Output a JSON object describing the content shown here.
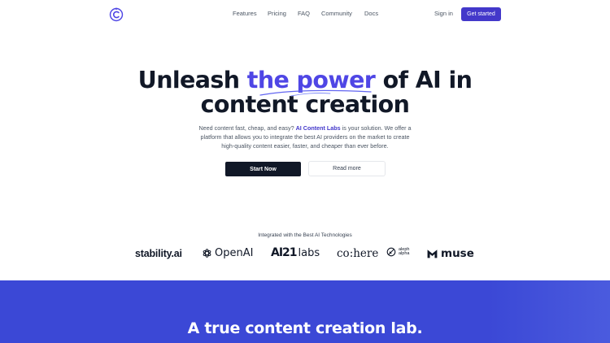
{
  "nav": {
    "links": [
      "Features",
      "Pricing",
      "FAQ",
      "Community",
      "Docs"
    ],
    "sign_in": "Sign in",
    "get_started": "Get started"
  },
  "hero": {
    "title_part1": "Unleash ",
    "title_accent": "the power",
    "title_part2": " of AI in",
    "title_line2": "content creation",
    "desc_part1": "Need content fast, cheap, and easy? ",
    "desc_brand": "AI Content Labs",
    "desc_part2": " is your solution. We offer a platform that allows you to integrate the best AI providers on the market to create high-quality content easier, faster, and cheaper than ever before.",
    "start_button": "Start Now",
    "read_button": "Read more"
  },
  "integrations": {
    "label": "Integrated with the Best AI Technologies",
    "partners": {
      "stability": "stability.ai",
      "openai": "OpenAI",
      "ai21_bold": "AI21",
      "ai21_light": "labs",
      "cohere": "co:here",
      "aleph_line1": "aleph",
      "aleph_line2": "alpha",
      "muse": "muse"
    }
  },
  "section2": {
    "title": "A true content creation lab."
  },
  "colors": {
    "accent": "#4f46e5",
    "button_primary": "#4338ca",
    "dark_button": "#111827",
    "blue_section": "#3b48d6"
  }
}
